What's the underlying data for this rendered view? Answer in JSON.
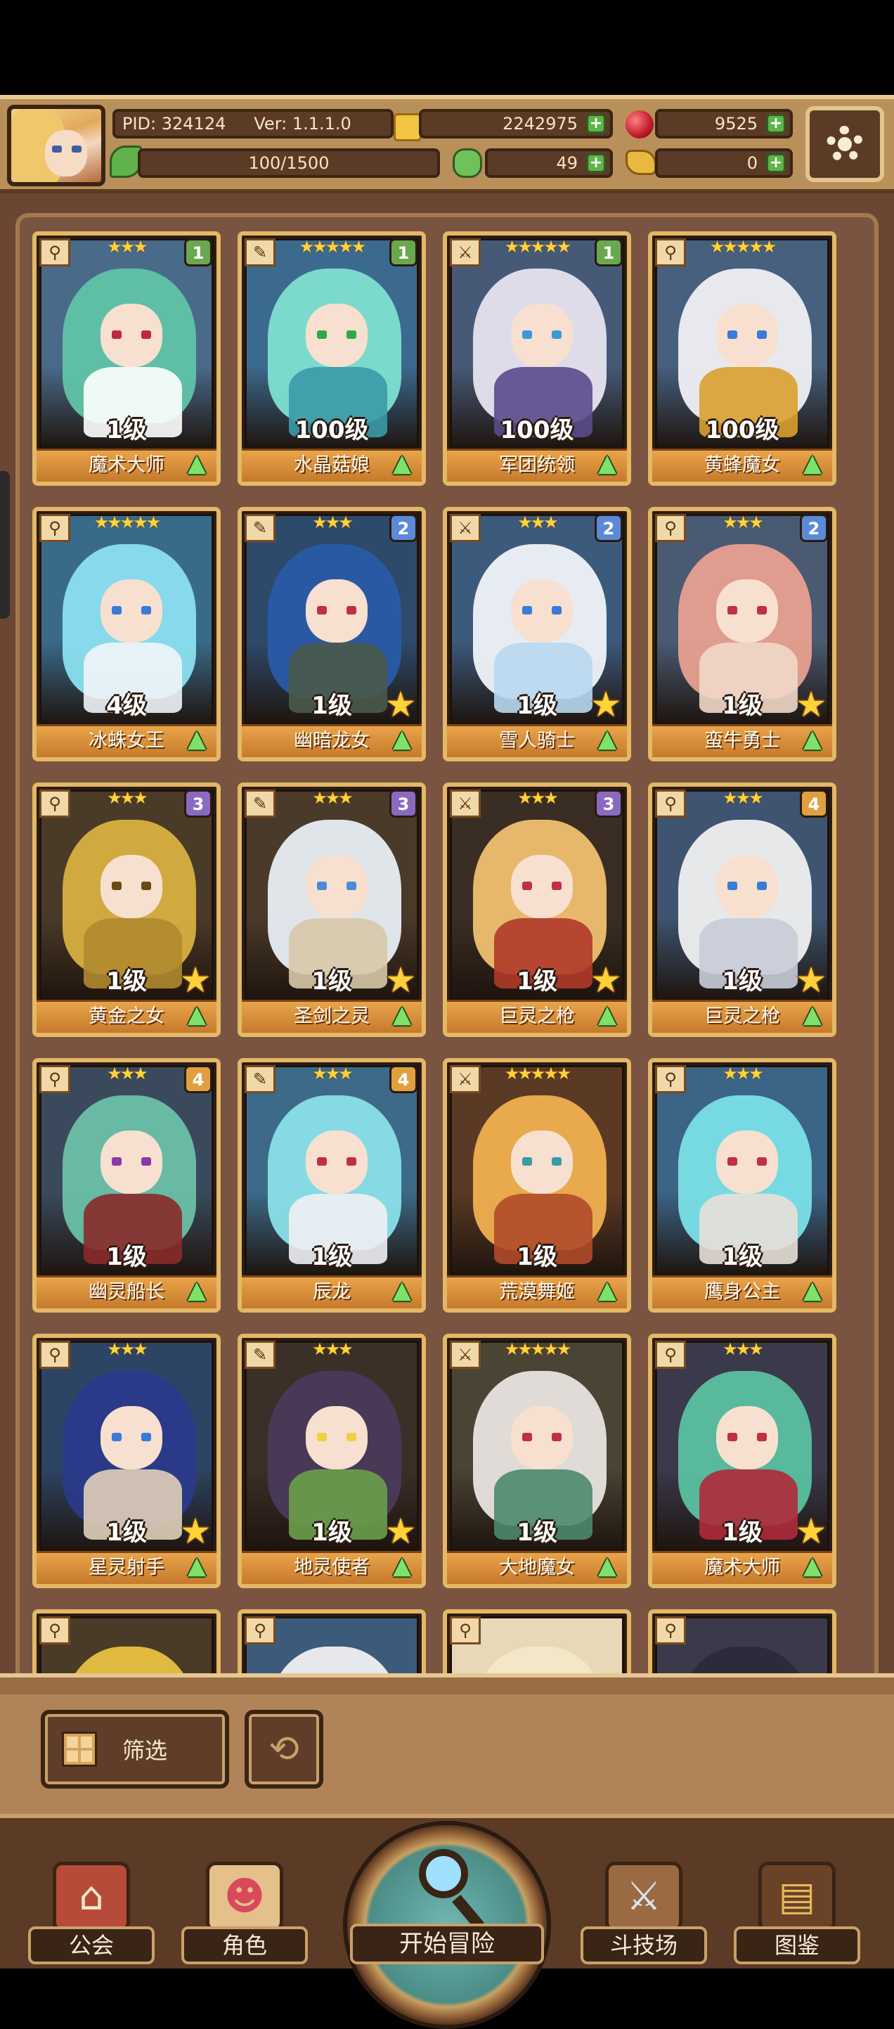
{
  "player": {
    "pid_label": "PID: 324124",
    "version_label": "Ver: 1.1.1.0",
    "energy": "100/1500"
  },
  "currency": {
    "gold": "2242975",
    "ruby": "9525",
    "clover": "49",
    "key": "0"
  },
  "heroes": [
    {
      "name": "魔术大师",
      "level": "1级",
      "stars": "★★★",
      "badge": "1",
      "badge_color": "#6aa84f",
      "hair": "#5fc4a8",
      "body": "#ffffff",
      "eye": "#c0283c",
      "bg": "#4a6a8a"
    },
    {
      "name": "水晶菇娘",
      "level": "100级",
      "stars": "★★★★★",
      "badge": "1",
      "badge_color": "#6aa84f",
      "hair": "#7ee0d0",
      "body": "#3a9aa8",
      "eye": "#2fa84a",
      "bg": "#3c6a8e"
    },
    {
      "name": "军团统领",
      "level": "100级",
      "stars": "★★★★★",
      "badge": "1",
      "badge_color": "#6aa84f",
      "hair": "#e8e4f0",
      "body": "#5a4a8a",
      "eye": "#3a9ad8",
      "bg": "#465a78"
    },
    {
      "name": "黄蜂魔女",
      "level": "100级",
      "stars": "★★★★★",
      "badge": "",
      "badge_color": "",
      "hair": "#f0f0f4",
      "body": "#d8a030",
      "eye": "#3a7ad8",
      "bg": "#46607e"
    },
    {
      "name": "冰蛛女王",
      "level": "4级",
      "stars": "★★★★★",
      "badge": "",
      "badge_color": "",
      "hair": "#8ae0f0",
      "body": "#f0f4f8",
      "eye": "#3a7ad8",
      "bg": "#3a6a8a"
    },
    {
      "name": "幽暗龙女",
      "level": "1级",
      "stars": "★★★",
      "badge": "2",
      "badge_color": "#5a8ad8",
      "hair": "#2a5aa8",
      "body": "#4a5a4a",
      "eye": "#c03040",
      "bg": "#2e4a6a"
    },
    {
      "name": "雪人骑士",
      "level": "1级",
      "stars": "★★★",
      "badge": "2",
      "badge_color": "#5a8ad8",
      "hair": "#f0f4fa",
      "body": "#b8d8f0",
      "eye": "#3a7ad8",
      "bg": "#3c5a7c"
    },
    {
      "name": "蛮牛勇士",
      "level": "1级",
      "stars": "★★★",
      "badge": "2",
      "badge_color": "#5a8ad8",
      "hair": "#e8a090",
      "body": "#f0d8c8",
      "eye": "#c03040",
      "bg": "#4a5a72"
    },
    {
      "name": "黄金之女",
      "level": "1级",
      "stars": "★★★",
      "badge": "3",
      "badge_color": "#8a6ac0",
      "hair": "#d8b040",
      "body": "#b08a30",
      "eye": "#6a4a10",
      "bg": "#4a3a28"
    },
    {
      "name": "圣剑之灵",
      "level": "1级",
      "stars": "★★★",
      "badge": "3",
      "badge_color": "#8a6ac0",
      "hair": "#e8eef4",
      "body": "#d8c8a8",
      "eye": "#4a8ad8",
      "bg": "#4a3a2a"
    },
    {
      "name": "巨灵之枪",
      "level": "1级",
      "stars": "★★★",
      "badge": "3",
      "badge_color": "#8a6ac0",
      "hair": "#f0c070",
      "body": "#b03a2a",
      "eye": "#c03040",
      "bg": "#3a2e24"
    },
    {
      "name": "巨灵之枪",
      "level": "1级",
      "stars": "★★★",
      "badge": "4",
      "badge_color": "#e0a040",
      "hair": "#f0f0f0",
      "body": "#c8ccd8",
      "eye": "#3a7ad8",
      "bg": "#3e5470"
    },
    {
      "name": "幽灵船长",
      "level": "1级",
      "stars": "★★★",
      "badge": "4",
      "badge_color": "#e0a040",
      "hair": "#6ac0a8",
      "body": "#8a2a2a",
      "eye": "#8a3aa8",
      "bg": "#3a4a5c"
    },
    {
      "name": "辰龙",
      "level": "1级",
      "stars": "★★★",
      "badge": "4",
      "badge_color": "#e0a040",
      "hair": "#8ae0e8",
      "body": "#f0f0f4",
      "eye": "#c03040",
      "bg": "#3c6a88"
    },
    {
      "name": "荒漠舞姬",
      "level": "1级",
      "stars": "★★★★★",
      "badge": "",
      "badge_color": "",
      "hair": "#f0b050",
      "body": "#b04a2a",
      "eye": "#3a9aa8",
      "bg": "#5a3a24"
    },
    {
      "name": "鹰身公主",
      "level": "1级",
      "stars": "★★★",
      "badge": "",
      "badge_color": "",
      "hair": "#7ae0e8",
      "body": "#e8e0d8",
      "eye": "#c03040",
      "bg": "#3c6486"
    },
    {
      "name": "星灵射手",
      "level": "1级",
      "stars": "★★★",
      "badge": "",
      "badge_color": "",
      "hair": "#2a3a8a",
      "body": "#e0d0b8",
      "eye": "#3a7ad8",
      "bg": "#2e4464"
    },
    {
      "name": "地灵使者",
      "level": "1级",
      "stars": "★★★",
      "badge": "",
      "badge_color": "",
      "hair": "#4a3a5a",
      "body": "#6aa04a",
      "eye": "#f0d040",
      "bg": "#3a3028"
    },
    {
      "name": "大地魔女",
      "level": "1级",
      "stars": "★★★★★",
      "badge": "",
      "badge_color": "",
      "hair": "#e8e4e0",
      "body": "#4a8a6a",
      "eye": "#c03040",
      "bg": "#4a4434"
    },
    {
      "name": "魔术大师",
      "level": "1级",
      "stars": "★★★",
      "badge": "",
      "badge_color": "",
      "hair": "#5ac0a0",
      "body": "#b02a3a",
      "eye": "#c03040",
      "bg": "#3a3a4c"
    }
  ],
  "partial_row": [
    {
      "hair": "#e8c040",
      "bg": "#4a3a28"
    },
    {
      "hair": "#f0f0f4",
      "bg": "#3c5a7a"
    },
    {
      "hair": "#f4e8c8",
      "bg": "#e8d8b8"
    },
    {
      "hair": "#2a2a3a",
      "bg": "#3a3a4c"
    }
  ],
  "toolbar": {
    "filter_label": "筛选"
  },
  "nav": {
    "guild": "公会",
    "heroes": "角色",
    "adventure": "开始冒险",
    "arena": "斗技场",
    "codex": "图鉴"
  }
}
